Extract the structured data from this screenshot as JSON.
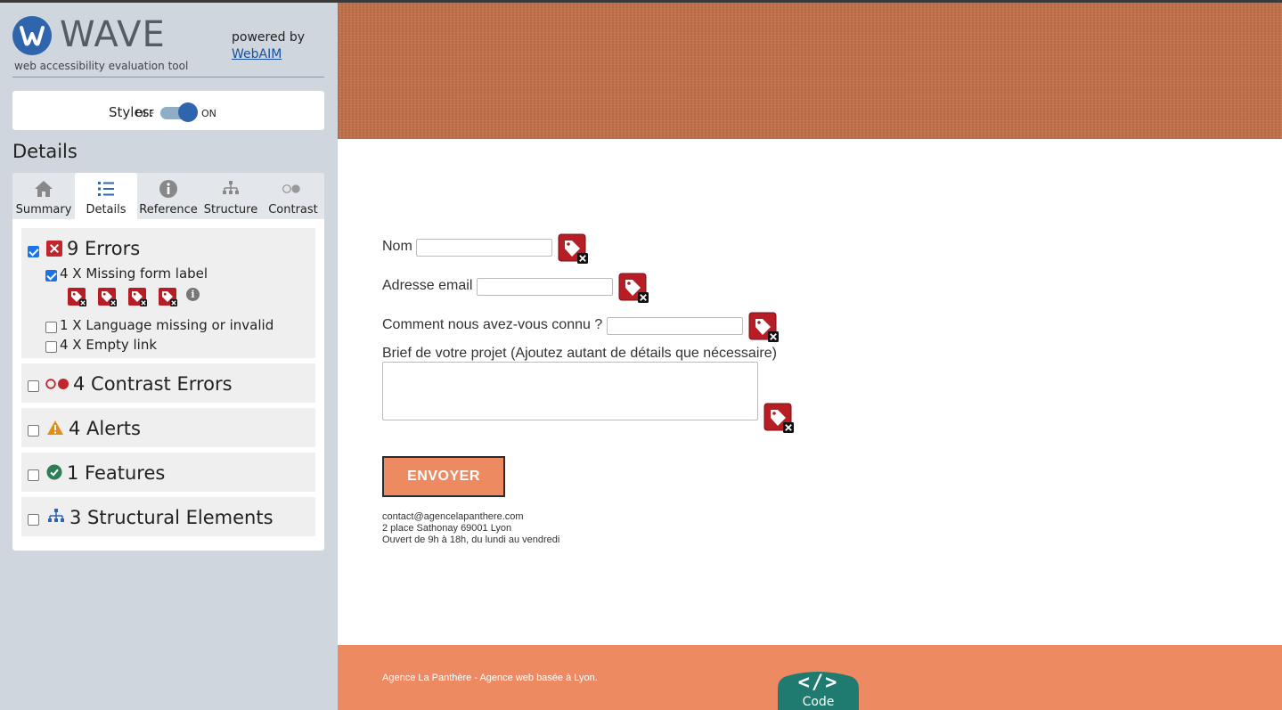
{
  "wave": {
    "title": "WAVE",
    "subtitle": "web accessibility evaluation tool",
    "powered_by": "powered by",
    "webaim_link": "WebAIM",
    "styles_label": "Styles:",
    "styles_off": "OFF",
    "styles_on": "ON",
    "details_heading": "Details",
    "brand_color": "#2f65ad",
    "error_color": "#c0262d"
  },
  "tabs": [
    {
      "label": "Summary",
      "icon": "home-icon"
    },
    {
      "label": "Details",
      "icon": "list-icon",
      "active": true
    },
    {
      "label": "Reference",
      "icon": "info-icon"
    },
    {
      "label": "Structure",
      "icon": "structure-icon"
    },
    {
      "label": "Contrast",
      "icon": "contrast-icon"
    }
  ],
  "details": {
    "errors": {
      "label": "9 Errors",
      "checked": true,
      "items": [
        {
          "label": "4 X Missing form label",
          "checked": true,
          "icon_count": 4
        },
        {
          "label": "1 X Language missing or invalid",
          "checked": false
        },
        {
          "label": "4 X Empty link",
          "checked": false
        }
      ]
    },
    "contrast": {
      "label": "4 Contrast Errors",
      "checked": false
    },
    "alerts": {
      "label": "4 Alerts",
      "checked": false
    },
    "features": {
      "label": "1 Features",
      "checked": false
    },
    "structure": {
      "label": "3 Structural Elements",
      "checked": false
    }
  },
  "page": {
    "form": {
      "name_label": "Nom",
      "email_label": "Adresse email",
      "source_label": "Comment nous avez-vous connu ?",
      "brief_label": "Brief de votre projet (Ajoutez autant de détails que nécessaire)",
      "submit_label": "ENVOYER"
    },
    "contact": {
      "email": "contact@agencelapanthere.com",
      "address": "2 place Sathonay 69001 Lyon",
      "hours": "Ouvert de 9h à 18h, du lundi au vendredi"
    },
    "footer_text": "Agence La Panthère - Agence web basée à Lyon.",
    "code_button_label": "Code",
    "code_button_glyph": "</>",
    "accent_color": "#ee8a62"
  }
}
